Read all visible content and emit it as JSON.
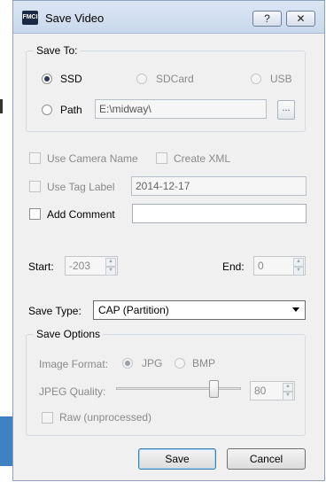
{
  "window": {
    "title": "Save Video",
    "app_icon_text": "FMCI",
    "help_label": "?",
    "close_label": "✕"
  },
  "save_to": {
    "group_title": "Save To:",
    "options": {
      "ssd": {
        "label": "SSD",
        "selected": true,
        "enabled": true
      },
      "sdcard": {
        "label": "SDCard",
        "selected": false,
        "enabled": false
      },
      "usb": {
        "label": "USB",
        "selected": false,
        "enabled": false
      },
      "path": {
        "label": "Path",
        "selected": false,
        "enabled": true
      }
    },
    "path_value": "E:\\midway\\",
    "browse_label": "..."
  },
  "options": {
    "use_camera_name": {
      "label": "Use Camera Name",
      "checked": false,
      "enabled": false
    },
    "create_xml": {
      "label": "Create XML",
      "checked": false,
      "enabled": false
    },
    "use_tag_label": {
      "label": "Use Tag Label",
      "checked": false,
      "enabled": false
    },
    "tag_label_value": "2014-12-17",
    "add_comment": {
      "label": "Add Comment",
      "checked": false,
      "enabled": true
    },
    "comment_value": ""
  },
  "range": {
    "start_label": "Start:",
    "start_value": "-203",
    "end_label": "End:",
    "end_value": "0"
  },
  "save_type": {
    "label": "Save Type:",
    "selected": "CAP (Partition)"
  },
  "save_options": {
    "group_title": "Save Options",
    "image_format_label": "Image Format:",
    "jpg_label": "JPG",
    "bmp_label": "BMP",
    "jpg_selected": true,
    "jpeg_quality_label": "JPEG Quality:",
    "jpeg_quality_value": "80",
    "jpeg_quality_fraction": 0.8,
    "raw_label": "Raw (unprocessed)",
    "raw_checked": false
  },
  "buttons": {
    "save": "Save",
    "cancel": "Cancel"
  }
}
